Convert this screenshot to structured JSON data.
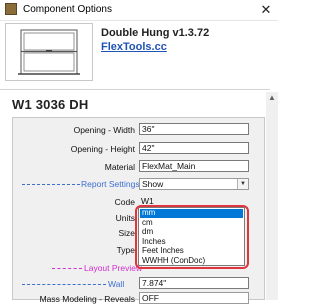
{
  "window": {
    "title": "Component Options",
    "close_glyph": "✕",
    "icon": "component-icon"
  },
  "header": {
    "component_name": "Double Hung v1.3.72",
    "link_text": "FlexTools.cc"
  },
  "entity_title": "W1 3036 DH",
  "fields": {
    "opening_width": {
      "label": "Opening - Width",
      "value": "36\""
    },
    "opening_height": {
      "label": "Opening - Height",
      "value": "42\""
    },
    "material": {
      "label": "Material",
      "value": "FlexMat_Main"
    },
    "report_settings": {
      "label": "Report Settings",
      "value": "Show"
    },
    "code": {
      "label": "Code",
      "value": "W1"
    },
    "units": {
      "label": "Units",
      "value": "mm"
    },
    "size": {
      "label": "Size"
    },
    "type": {
      "label": "Type"
    },
    "layout_preview": {
      "label": "Layout Preview"
    },
    "wall": {
      "label": "Wall",
      "value": "7.874\""
    },
    "mass_modeling": {
      "label": "Mass Modeling - Reveals",
      "value": "OFF"
    }
  },
  "units_dropdown": {
    "options": [
      "mm",
      "cm",
      "dm",
      "Inches",
      "Feet Inches",
      "WWHH (ConDoc)"
    ],
    "selected": "mm"
  },
  "colors": {
    "section_blue": "#3c6fd1",
    "section_magenta": "#d02ed0",
    "link_blue": "#1f54b5",
    "selection_blue": "#0078d7",
    "annotation_red": "#e0353d"
  }
}
